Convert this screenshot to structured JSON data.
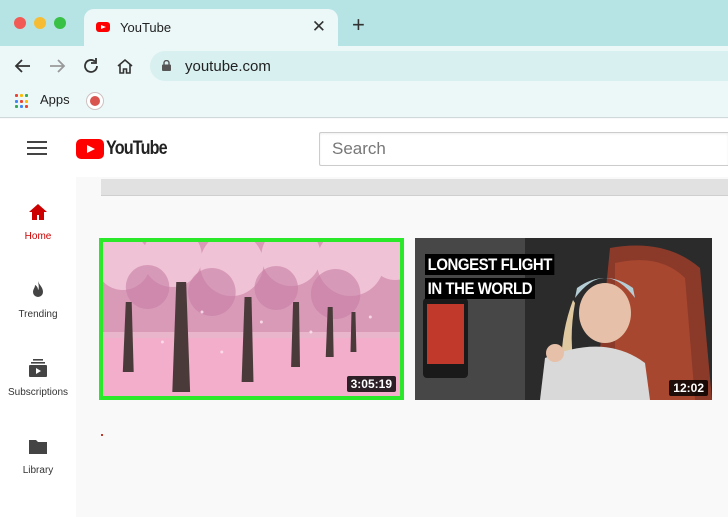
{
  "browser": {
    "tab": {
      "title": "YouTube",
      "close_glyph": "✕",
      "favicon": "youtube-favicon"
    },
    "new_tab_glyph": "+",
    "url": "youtube.com",
    "bookmarks": {
      "apps_label": "Apps"
    }
  },
  "youtube": {
    "logo_text": "YouTube",
    "search": {
      "placeholder": "Search",
      "value": ""
    },
    "sidebar": [
      {
        "label": "Home",
        "icon": "home-icon",
        "active": true
      },
      {
        "label": "Trending",
        "icon": "flame-icon",
        "active": false
      },
      {
        "label": "Subscriptions",
        "icon": "subscriptions-icon",
        "active": false
      },
      {
        "label": "Library",
        "icon": "folder-icon",
        "active": false
      }
    ],
    "videos": [
      {
        "duration": "3:05:19",
        "thumbnail": "pink cherry blossom trees",
        "selected": true
      },
      {
        "duration": "12:02",
        "caption_line1": "LONGEST FLIGHT",
        "caption_line2": "IN THE WORLD",
        "thumbnail": "woman in airplane seat"
      }
    ]
  },
  "colors": {
    "tabstrip": "#b6e3e3",
    "toolbar": "#ecf8f8",
    "youtube_red": "#ff0000",
    "active_sidebar": "#cc0000",
    "selection_highlight": "#2be82b"
  }
}
